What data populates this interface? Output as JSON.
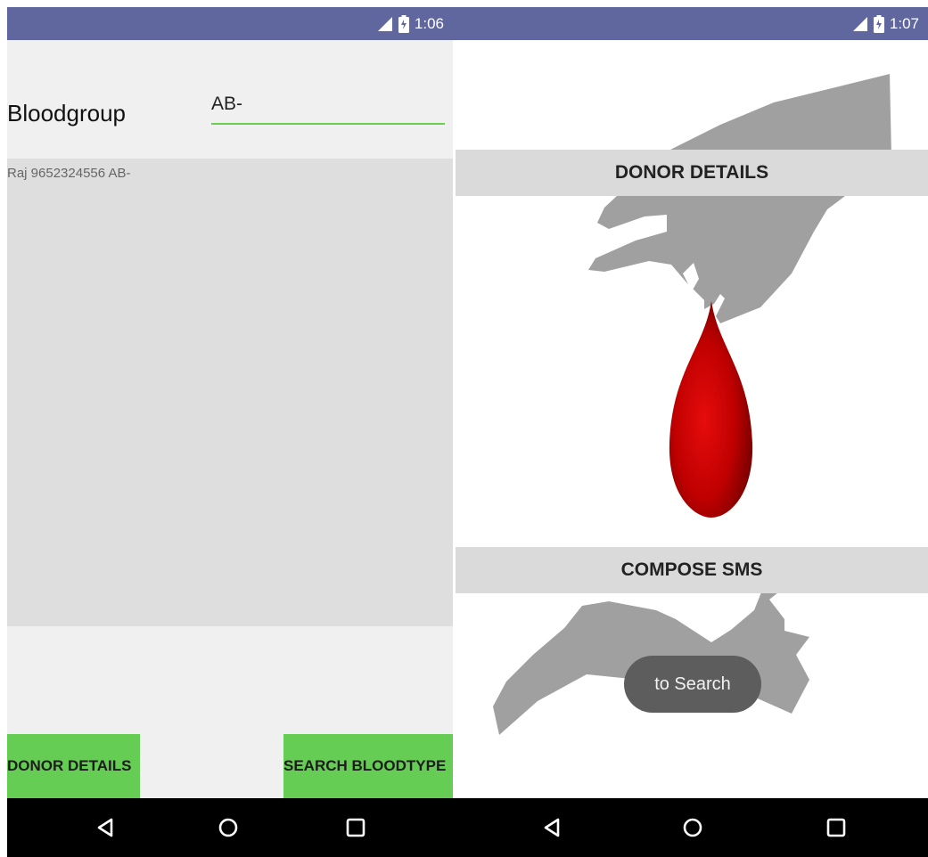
{
  "left_screen": {
    "status": {
      "time": "1:06"
    },
    "form": {
      "label": "Bloodgroup",
      "input_value": "AB-"
    },
    "results": [
      "Raj 9652324556 AB-"
    ],
    "buttons": {
      "donor_details": "DONOR DETAILS",
      "search_bloodtype": "SEARCH BLOODTYPE"
    }
  },
  "right_screen": {
    "status": {
      "time": "1:07"
    },
    "buttons": {
      "donor_details": "DONOR DETAILS",
      "compose_sms": "COMPOSE SMS"
    },
    "toast": "to Search"
  },
  "icons": {
    "status": [
      "signal-icon",
      "battery-icon"
    ],
    "navigation": [
      "back-icon",
      "home-icon",
      "recents-icon"
    ]
  },
  "colors": {
    "status_bar": "#5f679e",
    "accent_green": "#65cc54",
    "input_underline": "#6ccd52",
    "grey_button": "#dadada",
    "results_panel": "#dedede",
    "blood_drop": "#c40000",
    "nav_bar": "#000000"
  }
}
